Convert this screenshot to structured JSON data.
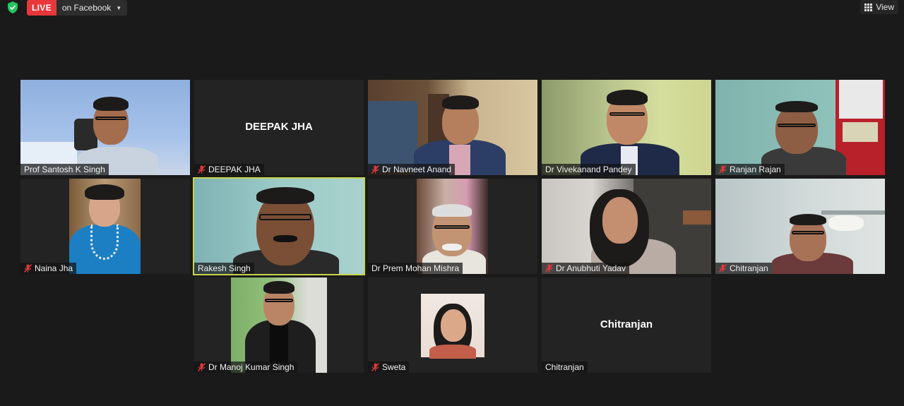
{
  "topbar": {
    "live_label": "LIVE",
    "stream_destination": "on Facebook",
    "view_label": "View"
  },
  "participants": [
    {
      "name": "Prof Santosh K Singh",
      "muted": false,
      "video": true
    },
    {
      "name": "DEEPAK JHA",
      "center_label": "DEEPAK JHA",
      "muted": true,
      "video": false
    },
    {
      "name": "Dr Navneet Anand",
      "muted": true,
      "video": true
    },
    {
      "name": "Dr Vivekanand Pandey",
      "muted": false,
      "video": true
    },
    {
      "name": "Ranjan Rajan",
      "muted": true,
      "video": true
    },
    {
      "name": "Naina Jha",
      "muted": true,
      "video": true
    },
    {
      "name": "Rakesh Singh",
      "muted": false,
      "video": true,
      "active_speaker": true
    },
    {
      "name": "Dr Prem Mohan Mishra",
      "muted": false,
      "video": true
    },
    {
      "name": "Dr Anubhuti Yadav",
      "muted": true,
      "video": true
    },
    {
      "name": "Chitranjan",
      "muted": true,
      "video": true
    },
    {
      "name": "Dr Manoj Kumar Singh",
      "muted": true,
      "video": true
    },
    {
      "name": "Sweta",
      "muted": true,
      "video": true
    },
    {
      "name": "Chitranjan",
      "center_label": "Chitranjan",
      "muted": false,
      "video": false
    }
  ],
  "colors": {
    "live_red": "#e8373b",
    "active_speaker_border": "#c7d34a",
    "mute_icon": "#e0393d",
    "security_shield": "#23c45e"
  }
}
